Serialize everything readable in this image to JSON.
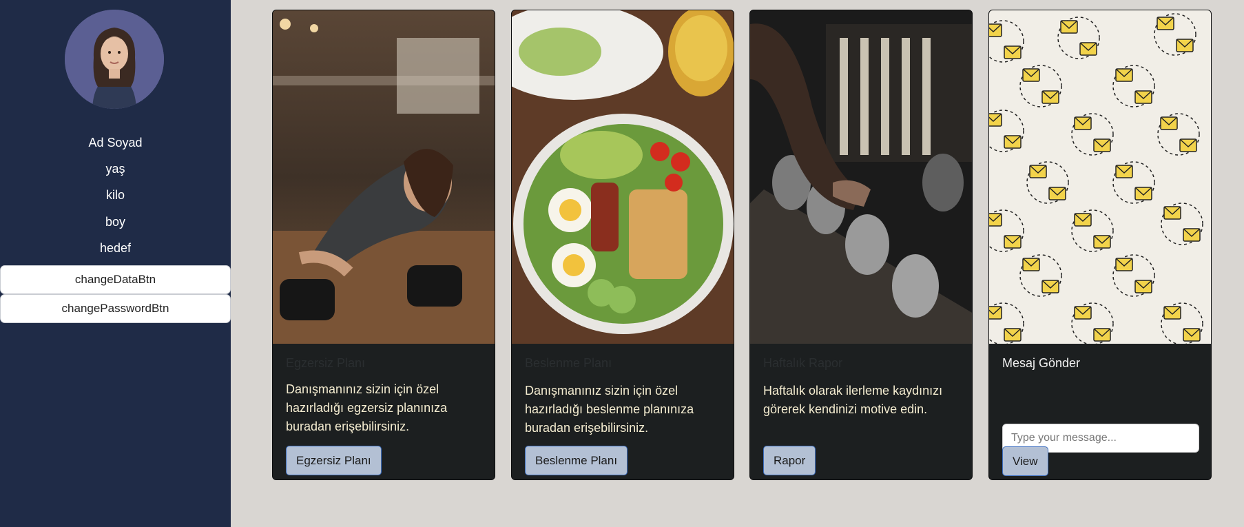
{
  "profile": {
    "name": "Ad Soyad",
    "age": "yaş",
    "weight": "kilo",
    "height": "boy",
    "goal": "hedef"
  },
  "sidebar_buttons": {
    "change_data": "changeDataBtn",
    "change_password": "changePasswordBtn"
  },
  "cards": [
    {
      "title": "Egzersiz Planı",
      "text": "Danışmanınız sizin için özel hazırladığı egzersiz planınıza buradan erişebilirsiniz.",
      "button": "Egzersiz Planı"
    },
    {
      "title": "Beslenme Planı",
      "text": "Danışmanınız sizin için özel hazırladığı beslenme planınıza buradan erişebilirsiniz.",
      "button": "Beslenme Planı"
    },
    {
      "title": "Haftalık Rapor",
      "text": "Haftalık olarak ilerleme kaydınızı görerek kendinizi motive edin.",
      "button": "Rapor"
    },
    {
      "title": "Mesaj Gönder",
      "input_placeholder": "Type your message...",
      "button": "View"
    }
  ],
  "colors": {
    "sidebar_bg": "#1f2b47",
    "page_bg": "#d9d6d2",
    "card_bg": "#1c1f20",
    "button_bg": "#b3c0d4",
    "button_border": "#3d6fc0"
  }
}
